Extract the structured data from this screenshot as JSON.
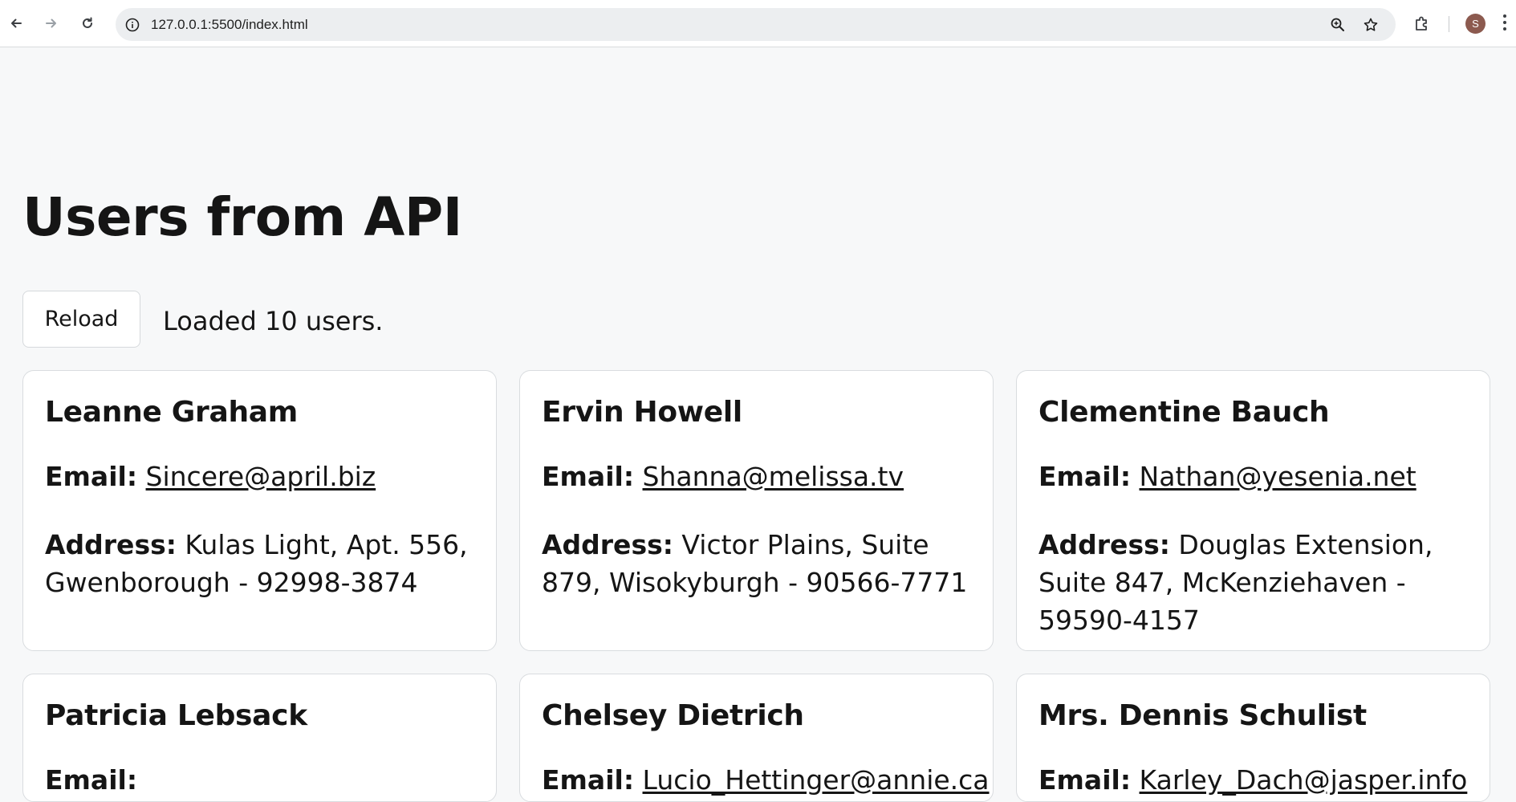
{
  "browser": {
    "url": "127.0.0.1:5500/index.html",
    "profile_initial": "S"
  },
  "page": {
    "title": "Users from API",
    "reload_label": "Reload",
    "status": "Loaded 10 users."
  },
  "labels": {
    "email": "Email:",
    "address": "Address:"
  },
  "users": [
    {
      "name": "Leanne Graham",
      "email": "Sincere@april.biz",
      "address": "Kulas Light, Apt. 556, Gwenborough - 92998-3874"
    },
    {
      "name": "Ervin Howell",
      "email": "Shanna@melissa.tv",
      "address": "Victor Plains, Suite 879, Wisokyburgh - 90566-7771"
    },
    {
      "name": "Clementine Bauch",
      "email": "Nathan@yesenia.net",
      "address": "Douglas Extension, Suite 847, McKenziehaven - 59590-4157"
    },
    {
      "name": "Patricia Lebsack",
      "email": "",
      "address": ""
    },
    {
      "name": "Chelsey Dietrich",
      "email": "Lucio_Hettinger@annie.ca",
      "address": ""
    },
    {
      "name": "Mrs. Dennis Schulist",
      "email": "Karley_Dach@jasper.info",
      "address": ""
    }
  ]
}
